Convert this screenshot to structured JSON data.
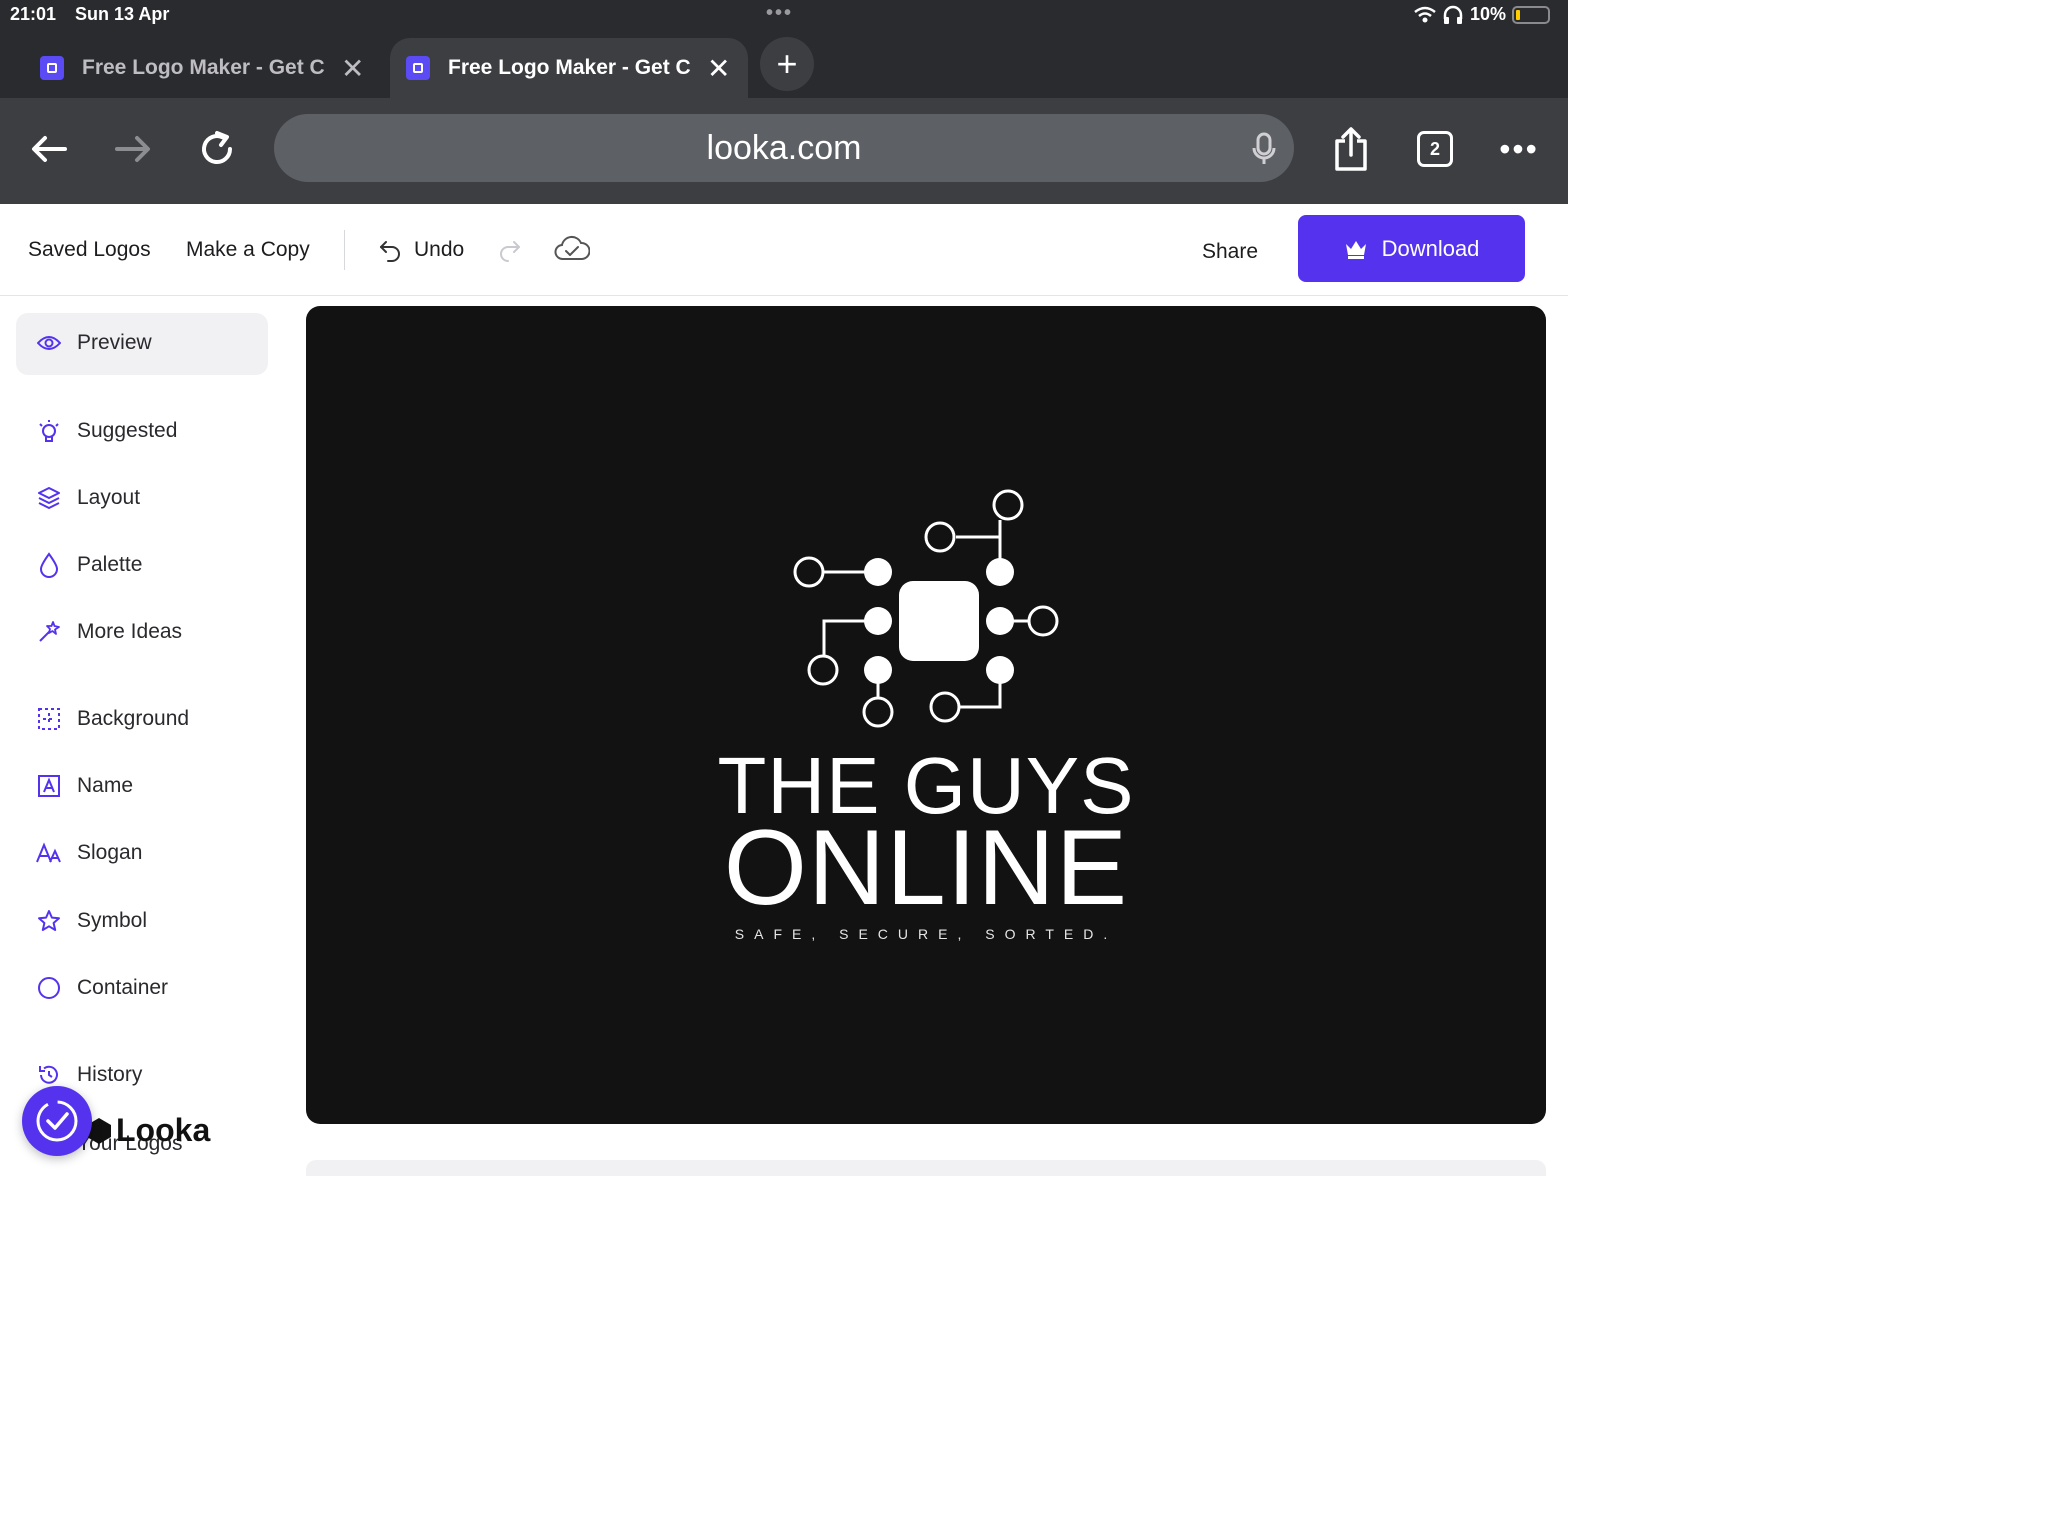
{
  "status_bar": {
    "time": "21:01",
    "date": "Sun 13 Apr",
    "battery": "10%",
    "battery_level_percent": 10
  },
  "tabs": [
    {
      "title": "Free Logo Maker - Get C",
      "active": false
    },
    {
      "title": "Free Logo Maker - Get C",
      "active": true
    }
  ],
  "address_bar": {
    "url": "looka.com",
    "tab_count": "2"
  },
  "app_toolbar": {
    "saved_logos": "Saved Logos",
    "make_copy": "Make a Copy",
    "undo": "Undo",
    "share": "Share",
    "download": "Download"
  },
  "sidebar": {
    "items": [
      {
        "label": "Preview",
        "icon": "eye-icon",
        "selected": true
      },
      {
        "label": "Suggested",
        "icon": "lightbulb-icon"
      },
      {
        "label": "Layout",
        "icon": "layers-icon"
      },
      {
        "label": "Palette",
        "icon": "droplet-icon"
      },
      {
        "label": "More Ideas",
        "icon": "magic-wand-icon"
      },
      {
        "label": "Background",
        "icon": "background-grid-icon"
      },
      {
        "label": "Name",
        "icon": "text-box-icon"
      },
      {
        "label": "Slogan",
        "icon": "font-size-icon"
      },
      {
        "label": "Symbol",
        "icon": "star-icon"
      },
      {
        "label": "Container",
        "icon": "circle-icon"
      },
      {
        "label": "History",
        "icon": "history-icon"
      }
    ],
    "your_logos": "Your Logos",
    "brand": "Looka"
  },
  "logo": {
    "name_line1": "THE GUYS",
    "name_line2": "ONLINE",
    "slogan": "SAFE, SECURE, SORTED.",
    "background_color": "#121212",
    "foreground_color": "#ffffff",
    "symbol": "circuit-chip-icon"
  },
  "colors": {
    "accent": "#5533ee",
    "browser_chrome": "#2a2b2e"
  }
}
